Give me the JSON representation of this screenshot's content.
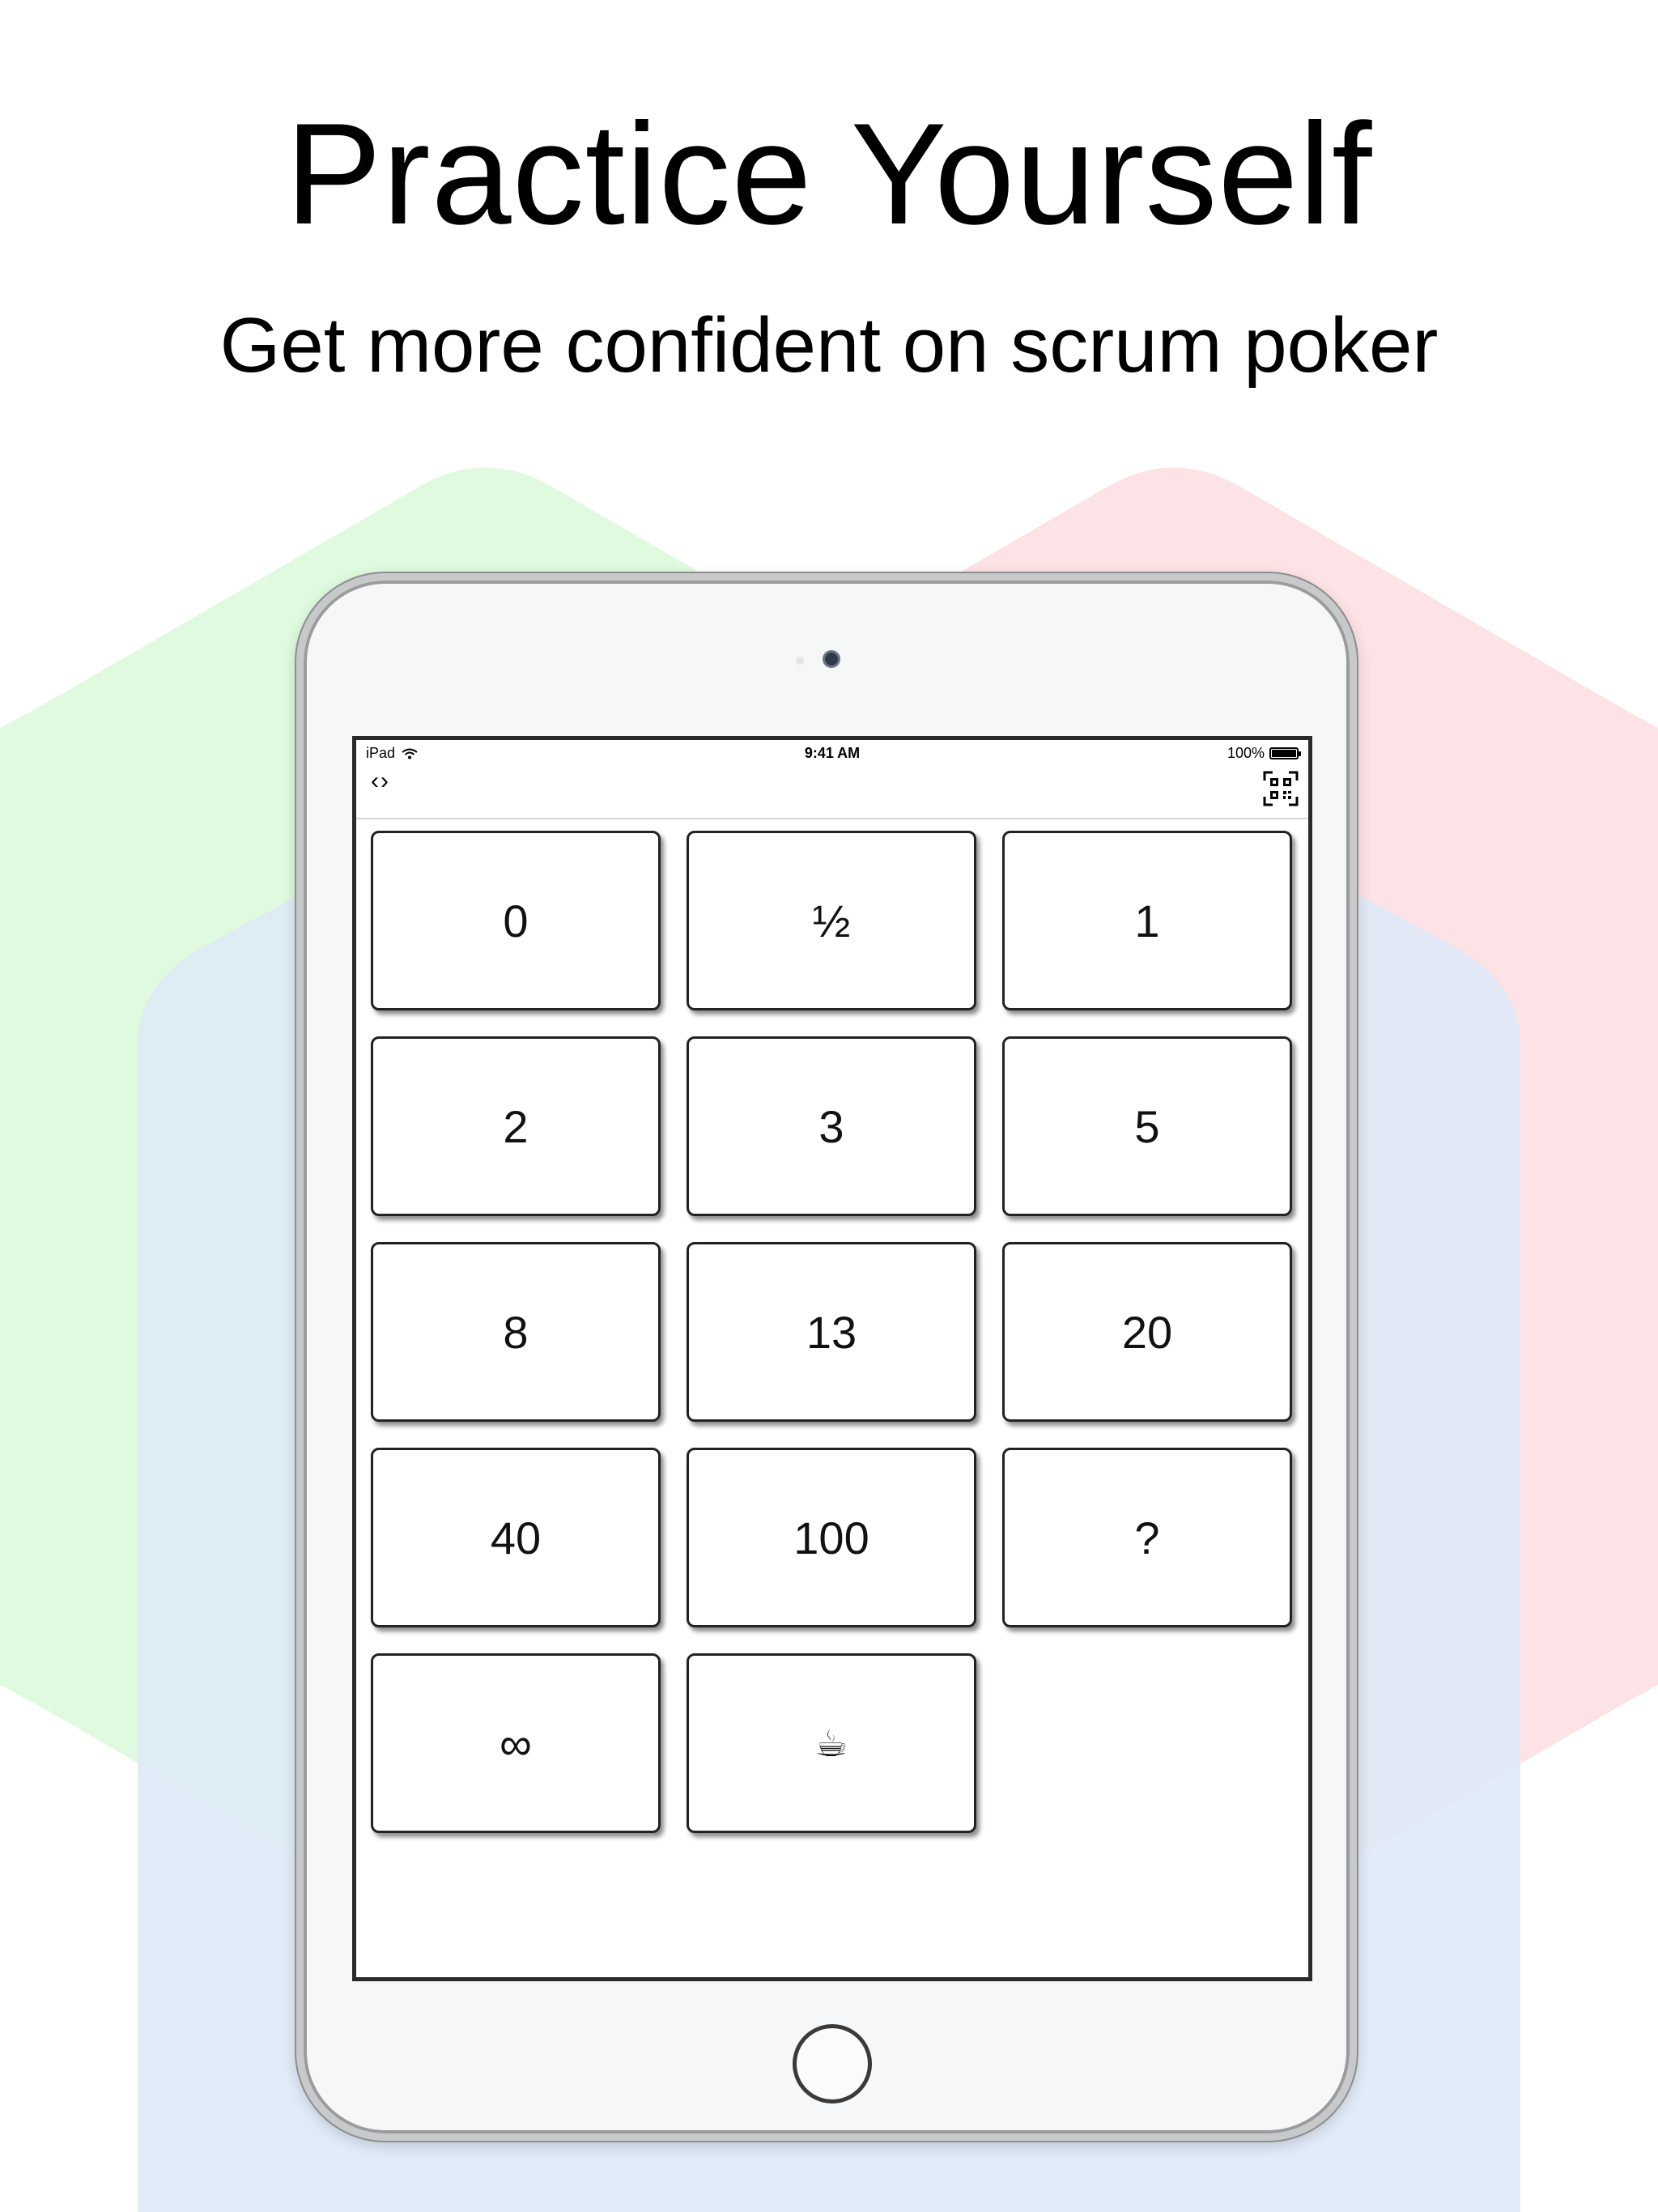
{
  "marketing": {
    "title": "Practice Yourself",
    "subtitle": "Get more confident on scrum poker"
  },
  "colors": {
    "hex_green": "#e0fadf",
    "hex_red": "#fde0e2",
    "hex_blue": "#dde9f8",
    "device_body": "#f6f7f8"
  },
  "status_bar": {
    "carrier": "iPad",
    "time": "9:41 AM",
    "battery": "100%"
  },
  "nav_bar": {
    "left_icon": "code-brackets-icon",
    "right_icon": "qr-code-scanner-icon"
  },
  "cards": [
    {
      "label": "0"
    },
    {
      "label": "½"
    },
    {
      "label": "1"
    },
    {
      "label": "2"
    },
    {
      "label": "3"
    },
    {
      "label": "5"
    },
    {
      "label": "8"
    },
    {
      "label": "13"
    },
    {
      "label": "20"
    },
    {
      "label": "40"
    },
    {
      "label": "100"
    },
    {
      "label": "?"
    },
    {
      "label": "∞"
    },
    {
      "label": "☕"
    }
  ]
}
